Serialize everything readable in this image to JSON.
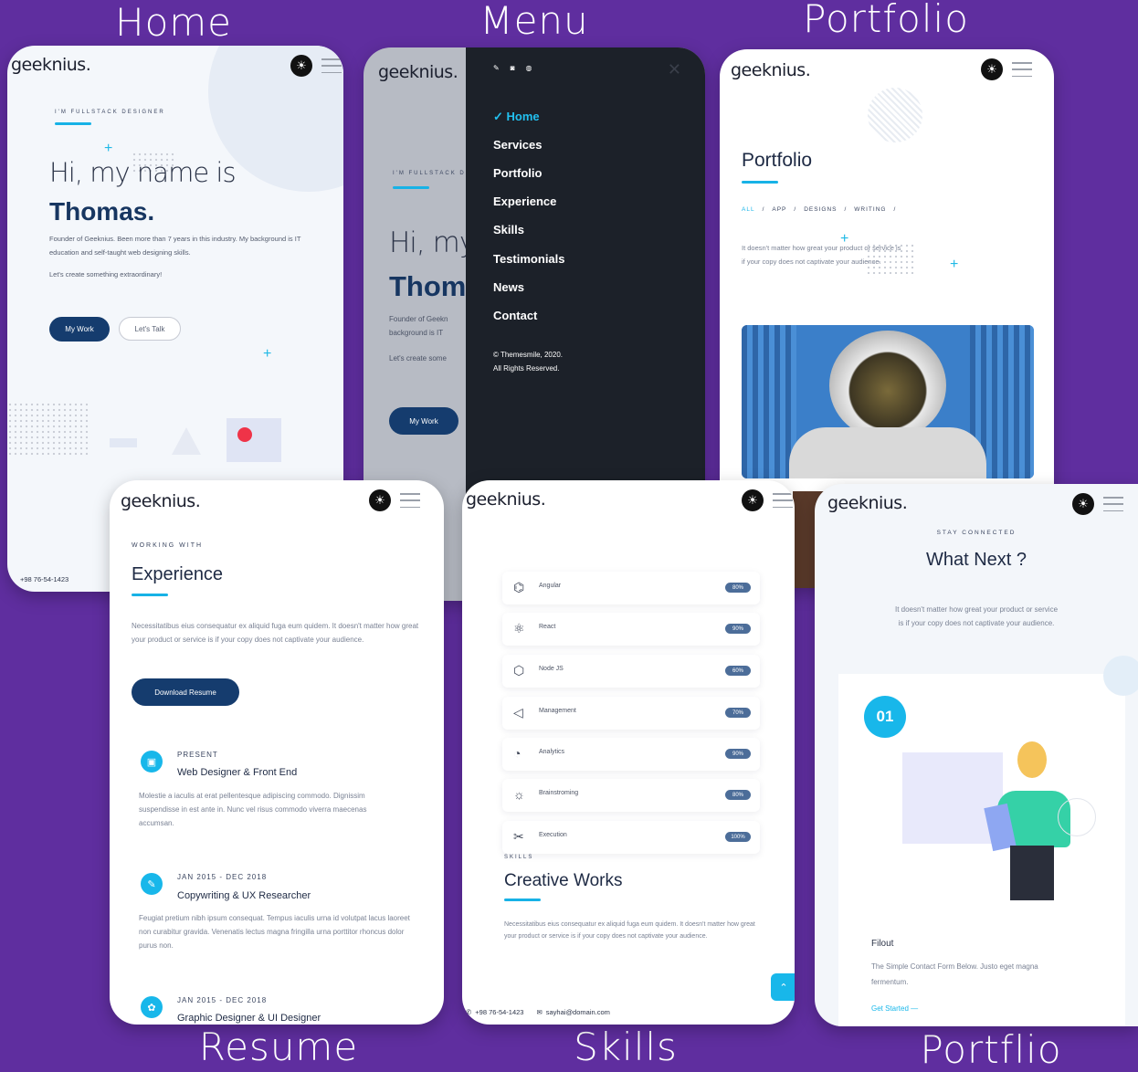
{
  "captions": {
    "home": "Home",
    "menu": "Menu",
    "portfolio": "Portfolio",
    "resume": "Resume",
    "skills": "Skills",
    "portflio": "Portflio"
  },
  "brand": {
    "logo": "geeknius."
  },
  "home": {
    "tag": "I'M FULLSTACK DESIGNER",
    "greeting": "Hi, my name is",
    "name": "Thomas.",
    "bio": "Founder of Geeknius. Been more than 7 years in this industry. My background is IT education and self-taught web designing skills.",
    "cta_text": "Let's create something extraordinary!",
    "btn_work": "My Work",
    "btn_talk": "Let's Talk",
    "phone": "+98 76-54-1423"
  },
  "menu": {
    "tag": "I'M FULLSTACK D",
    "greeting": "Hi, my",
    "name": "Thom",
    "bio": "Founder of Geekn background is IT",
    "cta_text": "Let's create some",
    "btn_work": "My Work",
    "social_icons": [
      "twitter-icon",
      "instagram-icon",
      "dribbble-icon"
    ],
    "items": [
      "Home",
      "Services",
      "Portfolio",
      "Experience",
      "Skills",
      "Testimonials",
      "News",
      "Contact"
    ],
    "active_index": 0,
    "copyright": "© Themesmile, 2020.",
    "rights": "All Rights Reserved."
  },
  "portfolio": {
    "title": "Portfolio",
    "filters": [
      "ALL",
      "APP",
      "DESIGNS",
      "WRITING"
    ],
    "text": "It doesn't matter how great your product or service is if your copy does not captivate your audience."
  },
  "resume": {
    "tag": "WORKING WITH",
    "title": "Experience",
    "text": "Necessitatibus eius consequatur ex aliquid fuga eum quidem. It doesn't matter how great your product or service is if your copy does not captivate your audience.",
    "download": "Download Resume",
    "entries": [
      {
        "date": "PRESENT",
        "role": "Web Designer & Front End",
        "desc": "Molestie a iaculis at erat pellentesque adipiscing commodo. Dignissim suspendisse in est ante in. Nunc vel risus commodo viverra maecenas accumsan."
      },
      {
        "date": "JAN 2015 - DEC 2018",
        "role": "Copywriting & UX Researcher",
        "desc": "Feugiat pretium nibh ipsum consequat. Tempus iaculis urna id volutpat lacus laoreet non curabitur gravida. Venenatis lectus magna fringilla urna porttitor rhoncus dolor purus non."
      },
      {
        "date": "JAN 2015 - DEC 2018",
        "role": "Graphic Designer & UI Designer",
        "desc": ""
      }
    ]
  },
  "skills": {
    "items": [
      {
        "icon": "angular-icon",
        "name": "Angular",
        "pct": "80%"
      },
      {
        "icon": "react-icon",
        "name": "React",
        "pct": "90%"
      },
      {
        "icon": "node-icon",
        "name": "Node JS",
        "pct": "60%"
      },
      {
        "icon": "management-icon",
        "name": "Management",
        "pct": "70%"
      },
      {
        "icon": "analytics-icon",
        "name": "Analytics",
        "pct": "90%"
      },
      {
        "icon": "brainstorming-icon",
        "name": "Brainstroming",
        "pct": "80%"
      },
      {
        "icon": "execution-icon",
        "name": "Execution",
        "pct": "100%"
      }
    ],
    "tag": "SKILLS",
    "title": "Creative Works",
    "text": "Necessitatibus eius consequatur ex aliquid fuga eum quidem. It doesn't matter how great your product or service is if your copy does not captivate your audience.",
    "phone": "+98 76-54-1423",
    "email": "sayhai@domain.com"
  },
  "portflio2": {
    "tag": "STAY CONNECTED",
    "title": "What Next ?",
    "text1": "It doesn't matter how great your product or service",
    "text2": "is if your copy does not captivate your audience.",
    "step": "01",
    "card_title": "Filout",
    "card_text": "The Simple Contact Form Below. Justo eget magna fermentum.",
    "link": "Get Started"
  },
  "colors": {
    "background": "#5f2e9f",
    "accent": "#17b2e6",
    "dark_button": "#153c6e",
    "menu_bg": "#1c2129"
  }
}
